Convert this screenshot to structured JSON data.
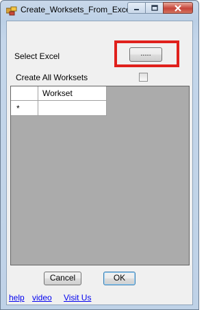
{
  "window": {
    "title": "Create_Worksets_From_Excel"
  },
  "form": {
    "select_excel_label": "Select Excel",
    "browse_button_label": ".....",
    "create_all_label": "Create All Worksets",
    "create_all_checked": false
  },
  "grid": {
    "columns": [
      "Workset"
    ],
    "new_row_marker": "*"
  },
  "buttons": {
    "cancel_label": "Cancel",
    "ok_label": "OK"
  },
  "links": {
    "help": "help",
    "video": "video",
    "visit_us": "Visit Us"
  },
  "colors": {
    "highlight": "#e0201c",
    "grid_background": "#ababab",
    "link": "#0000ee"
  }
}
